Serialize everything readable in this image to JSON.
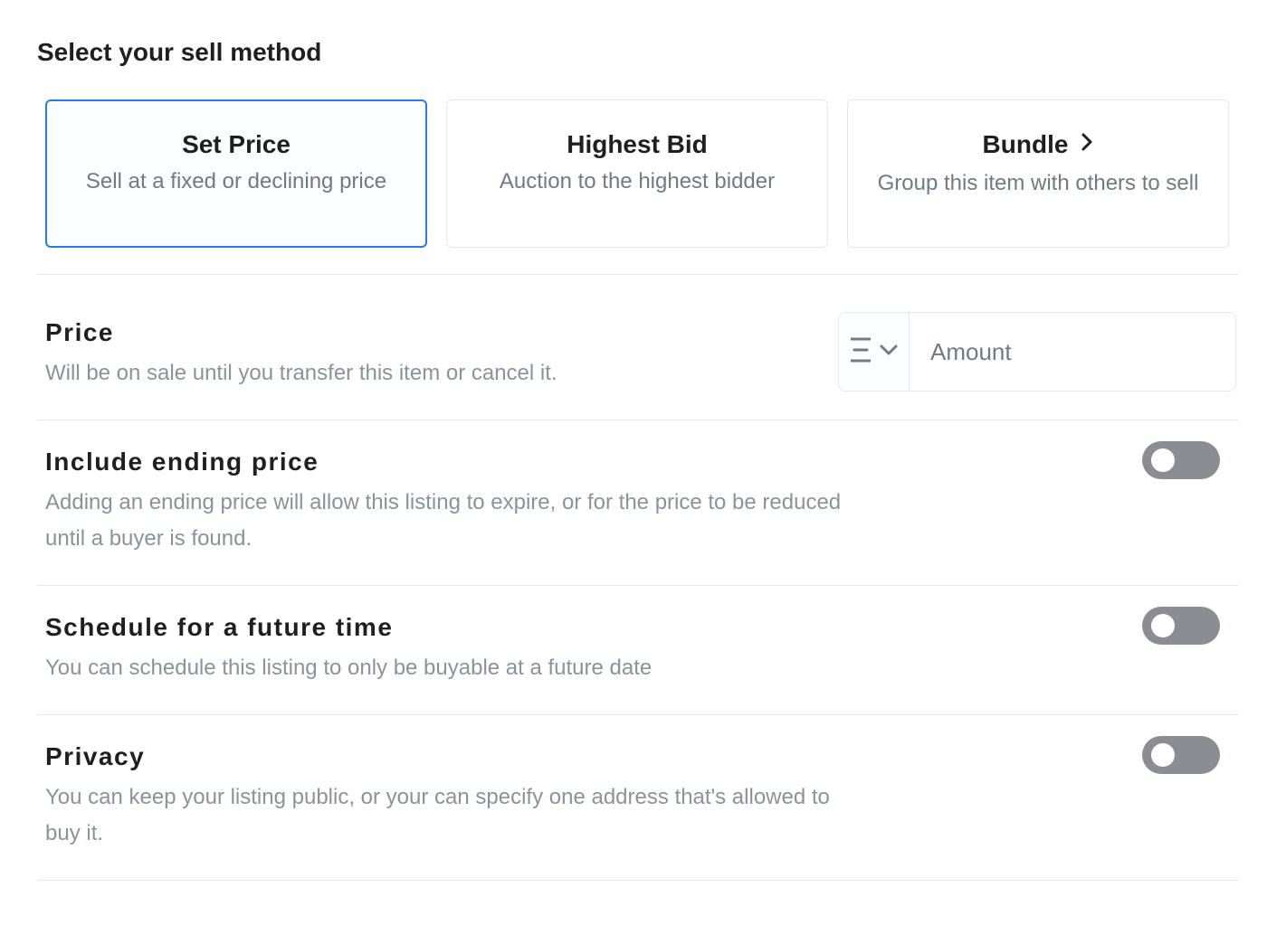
{
  "page": {
    "title": "Select your sell method"
  },
  "sell_methods": [
    {
      "title": "Set Price",
      "subtitle": "Sell at a fixed or declining price",
      "selected": true
    },
    {
      "title": "Highest Bid",
      "subtitle": "Auction to the highest bidder",
      "selected": false
    },
    {
      "title": "Bundle",
      "subtitle": "Group this item with others to sell",
      "selected": false,
      "icon": "chevron-right-icon"
    }
  ],
  "price": {
    "title": "Price",
    "description": "Will be on sale until you transfer this item or cancel it.",
    "currency_icon": "ethereum-icon",
    "dropdown_icon": "chevron-down-icon",
    "amount_placeholder": "Amount",
    "amount_value": ""
  },
  "options": [
    {
      "title": "Include ending price",
      "description": "Adding an ending price will allow this listing to expire, or for the price to be reduced until a buyer is found.",
      "enabled": false
    },
    {
      "title": "Schedule for a future time",
      "description": "You can schedule this listing to only be buyable at a future date",
      "enabled": false
    },
    {
      "title": "Privacy",
      "description": "You can keep your listing public, or your can specify one address that's allowed to buy it.",
      "enabled": false
    }
  ],
  "colors": {
    "accent": "#2081e2",
    "toggle_off": "#8a8e93",
    "divider": "#e5e8eb",
    "muted_text": "#8a939b"
  }
}
